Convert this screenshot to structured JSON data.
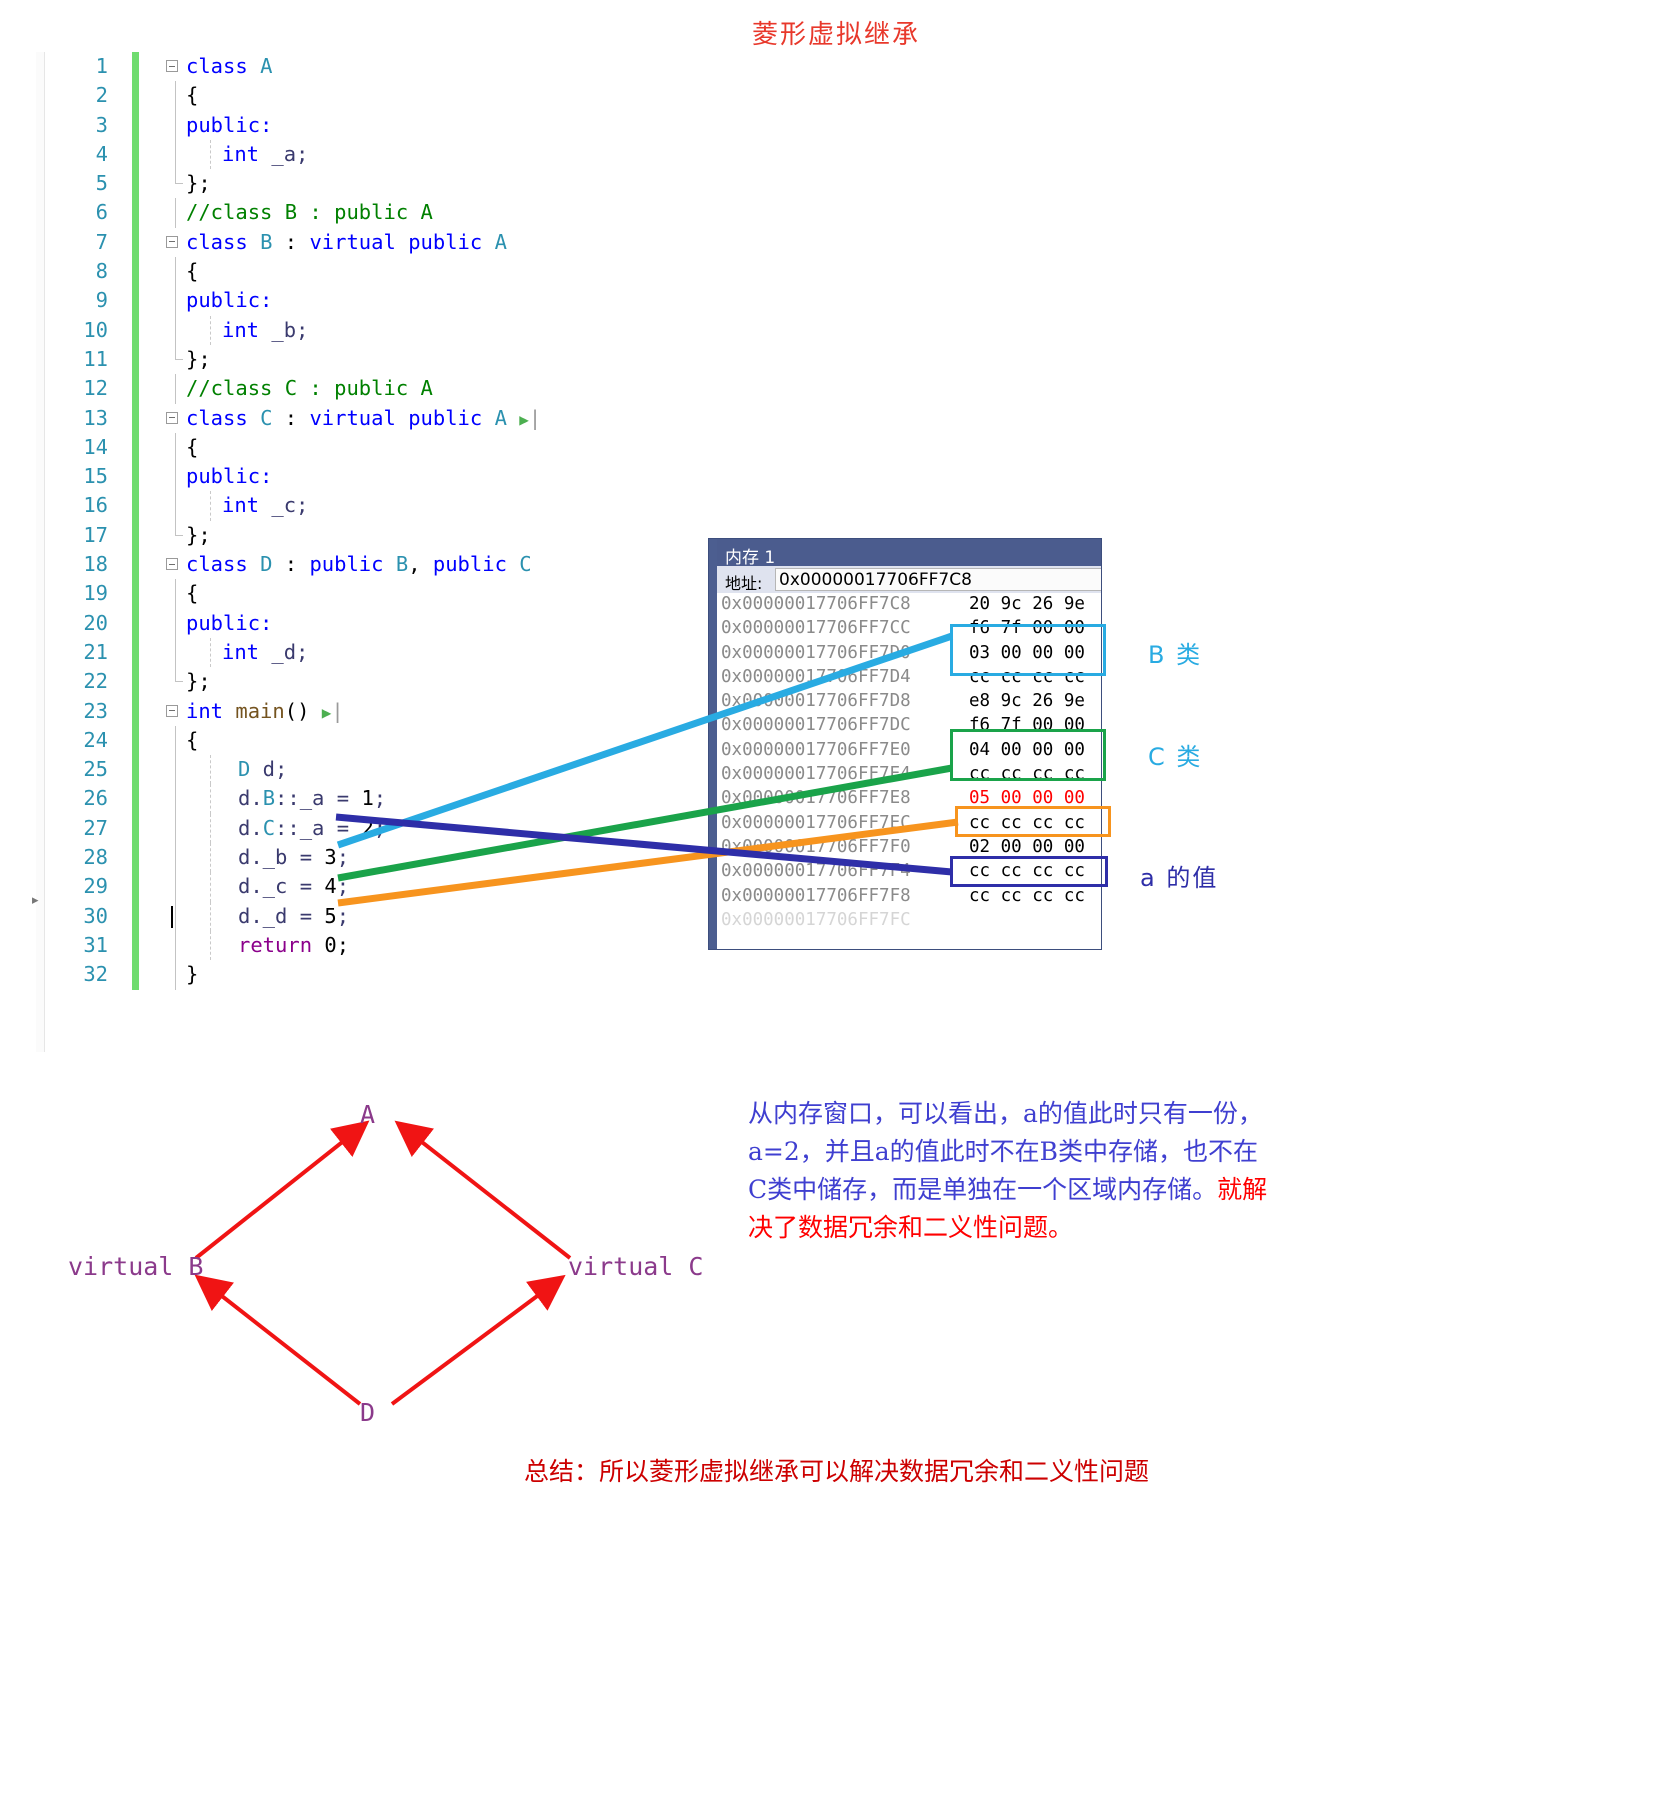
{
  "title": "菱形虚拟继承",
  "editor": {
    "lines": [
      {
        "n": "1",
        "text": "class A",
        "kind": "classdecl"
      },
      {
        "n": "2",
        "text": "{",
        "kind": "brace"
      },
      {
        "n": "3",
        "text": "public:",
        "kind": "access"
      },
      {
        "n": "4",
        "text": "int _a;",
        "kind": "member"
      },
      {
        "n": "5",
        "text": "};",
        "kind": "endbrace"
      },
      {
        "n": "6",
        "text": "//class B : public A",
        "kind": "comment"
      },
      {
        "n": "7",
        "text": "class B : virtual public A",
        "kind": "classdecl"
      },
      {
        "n": "8",
        "text": "{",
        "kind": "brace"
      },
      {
        "n": "9",
        "text": "public:",
        "kind": "access"
      },
      {
        "n": "10",
        "text": "int _b;",
        "kind": "member"
      },
      {
        "n": "11",
        "text": "};",
        "kind": "endbrace"
      },
      {
        "n": "12",
        "text": "//class C : public A",
        "kind": "comment"
      },
      {
        "n": "13",
        "text": "class C : virtual public A",
        "kind": "classdecl"
      },
      {
        "n": "14",
        "text": "{",
        "kind": "brace"
      },
      {
        "n": "15",
        "text": "public:",
        "kind": "access"
      },
      {
        "n": "16",
        "text": "int _c;",
        "kind": "member"
      },
      {
        "n": "17",
        "text": "};",
        "kind": "endbrace"
      },
      {
        "n": "18",
        "text": "class D : public B, public C",
        "kind": "classdecl"
      },
      {
        "n": "19",
        "text": "{",
        "kind": "brace"
      },
      {
        "n": "20",
        "text": "public:",
        "kind": "access"
      },
      {
        "n": "21",
        "text": "int _d;",
        "kind": "member"
      },
      {
        "n": "22",
        "text": "};",
        "kind": "endbrace"
      },
      {
        "n": "23",
        "text": "int main()",
        "kind": "mainfn"
      },
      {
        "n": "24",
        "text": "{",
        "kind": "brace"
      },
      {
        "n": "25",
        "text": "D d;",
        "kind": "stmt"
      },
      {
        "n": "26",
        "text": "d.B::_a = 1;",
        "kind": "stmt"
      },
      {
        "n": "27",
        "text": "d.C::_a = 2;",
        "kind": "stmt"
      },
      {
        "n": "28",
        "text": "d._b = 3;",
        "kind": "stmt"
      },
      {
        "n": "29",
        "text": "d._c = 4;",
        "kind": "stmt"
      },
      {
        "n": "30",
        "text": "d._d = 5;",
        "kind": "stmt"
      },
      {
        "n": "31",
        "text": "return 0;",
        "kind": "ret"
      },
      {
        "n": "32",
        "text": "}",
        "kind": "brace"
      }
    ]
  },
  "memory_window": {
    "title": "内存 1",
    "address_label": "地址:",
    "address_value": "0x00000017706FF7C8",
    "rows": [
      {
        "addr": "0x00000017706FF7C8",
        "hex": "20 9c 26 9e",
        "red": false
      },
      {
        "addr": "0x00000017706FF7CC",
        "hex": "f6 7f 00 00",
        "red": false
      },
      {
        "addr": "0x00000017706FF7D0",
        "hex": "03 00 00 00",
        "red": false
      },
      {
        "addr": "0x00000017706FF7D4",
        "hex": "cc cc cc cc",
        "red": false
      },
      {
        "addr": "0x00000017706FF7D8",
        "hex": "e8 9c 26 9e",
        "red": false
      },
      {
        "addr": "0x00000017706FF7DC",
        "hex": "f6 7f 00 00",
        "red": false
      },
      {
        "addr": "0x00000017706FF7E0",
        "hex": "04 00 00 00",
        "red": false
      },
      {
        "addr": "0x00000017706FF7E4",
        "hex": "cc cc cc cc",
        "red": false
      },
      {
        "addr": "0x00000017706FF7E8",
        "hex": "05 00 00 00",
        "red": true
      },
      {
        "addr": "0x00000017706FF7EC",
        "hex": "cc cc cc cc",
        "red": false
      },
      {
        "addr": "0x00000017706FF7F0",
        "hex": "02 00 00 00",
        "red": false
      },
      {
        "addr": "0x00000017706FF7F4",
        "hex": "cc cc cc cc",
        "red": false
      },
      {
        "addr": "0x00000017706FF7F8",
        "hex": "cc cc cc cc",
        "red": false
      },
      {
        "addr": "0x00000017706FF7FC",
        "hex": "",
        "red": false
      }
    ]
  },
  "highlight_labels": {
    "b_class": "B 类",
    "c_class": "C 类",
    "a_value": "a 的值"
  },
  "colors": {
    "blue": "#29abe2",
    "green": "#1aa34a",
    "orange": "#f7941e",
    "navy": "#2e2ea8",
    "red": "#ff0000",
    "purple": "#8b3a8b",
    "title_red": "#e8382b",
    "anno_blue": "#3f3fd0"
  },
  "diagram": {
    "nodes": {
      "a": "A",
      "b": "virtual B",
      "c": "virtual C",
      "d": "D"
    }
  },
  "annotations": {
    "note_blue_part1": "从内存窗口，可以看出，a的值此时只有一份，a=2，并且a的值此时不在B类中存储，也不在C类中储存，而是单独在一个区域内存储。",
    "note_red_part2": "就解决了数据冗余和二义性问题。",
    "summary": "总结：所以菱形虚拟继承可以解决数据冗余和二义性问题"
  }
}
